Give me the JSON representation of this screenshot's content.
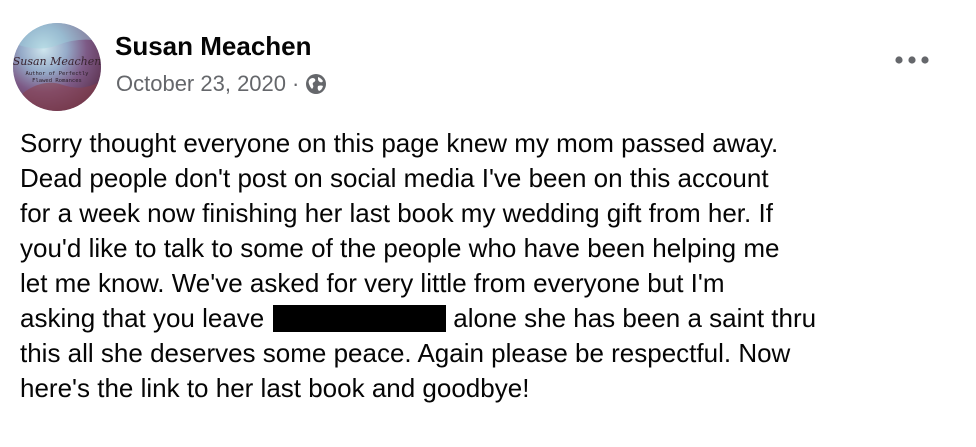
{
  "post": {
    "author": {
      "name": "Susan Meachen",
      "avatar_text": [
        "Susan Meachen",
        "Author of Perfectly",
        "Flawed Romances"
      ]
    },
    "date": "October 23, 2020",
    "date_separator": "·",
    "audience_icon": "globe-icon",
    "more_icon": "more-options-icon",
    "body_lines": [
      "Sorry thought everyone on this page knew my mom passed away.",
      "Dead people don't post on social media I've been on this account",
      "for a week now finishing her last book my wedding gift from her. If",
      "you'd like to talk to some of the people who have been helping me",
      "let me know. We've asked for very little from everyone but I'm",
      "this all she deserves some peace. Again please be respectful. Now",
      "here's the link to her last book and goodbye!"
    ],
    "redacted_line": {
      "before": "asking that you leave",
      "after": "alone she has been a saint thru"
    }
  },
  "colors": {
    "text_primary": "#050505",
    "text_secondary": "#65676b",
    "redaction": "#000000",
    "background": "#ffffff"
  }
}
